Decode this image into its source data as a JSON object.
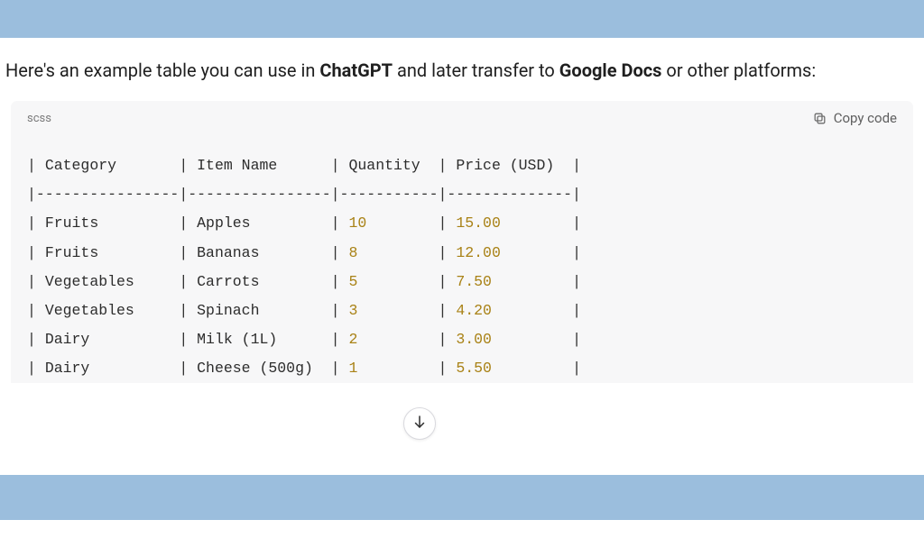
{
  "intro": {
    "pre": "Here's an example table you can use in ",
    "bold1": "ChatGPT",
    "mid": " and later transfer to ",
    "bold2": "Google Docs",
    "post": " or other platforms:"
  },
  "code": {
    "language": "scss",
    "copy_label": "Copy code"
  },
  "chart_data": {
    "type": "table",
    "columns": [
      "Category",
      "Item Name",
      "Quantity",
      "Price (USD)"
    ],
    "rows": [
      {
        "category": "Fruits",
        "item": "Apples",
        "qty": "10",
        "price": "15.00"
      },
      {
        "category": "Fruits",
        "item": "Bananas",
        "qty": "8",
        "price": "12.00"
      },
      {
        "category": "Vegetables",
        "item": "Carrots",
        "qty": "5",
        "price": "7.50"
      },
      {
        "category": "Vegetables",
        "item": "Spinach",
        "qty": "3",
        "price": "4.20"
      },
      {
        "category": "Dairy",
        "item": "Milk (1L)",
        "qty": "2",
        "price": "3.00"
      },
      {
        "category": "Dairy",
        "item": "Cheese (500g)",
        "qty": "1",
        "price": "5.50"
      }
    ]
  },
  "icons": {
    "copy": "copy-icon",
    "scroll_down": "arrow-down-icon"
  },
  "colors": {
    "bar": "#9bbedd",
    "code_bg": "#f7f7f8",
    "number_token": "#a98216"
  }
}
